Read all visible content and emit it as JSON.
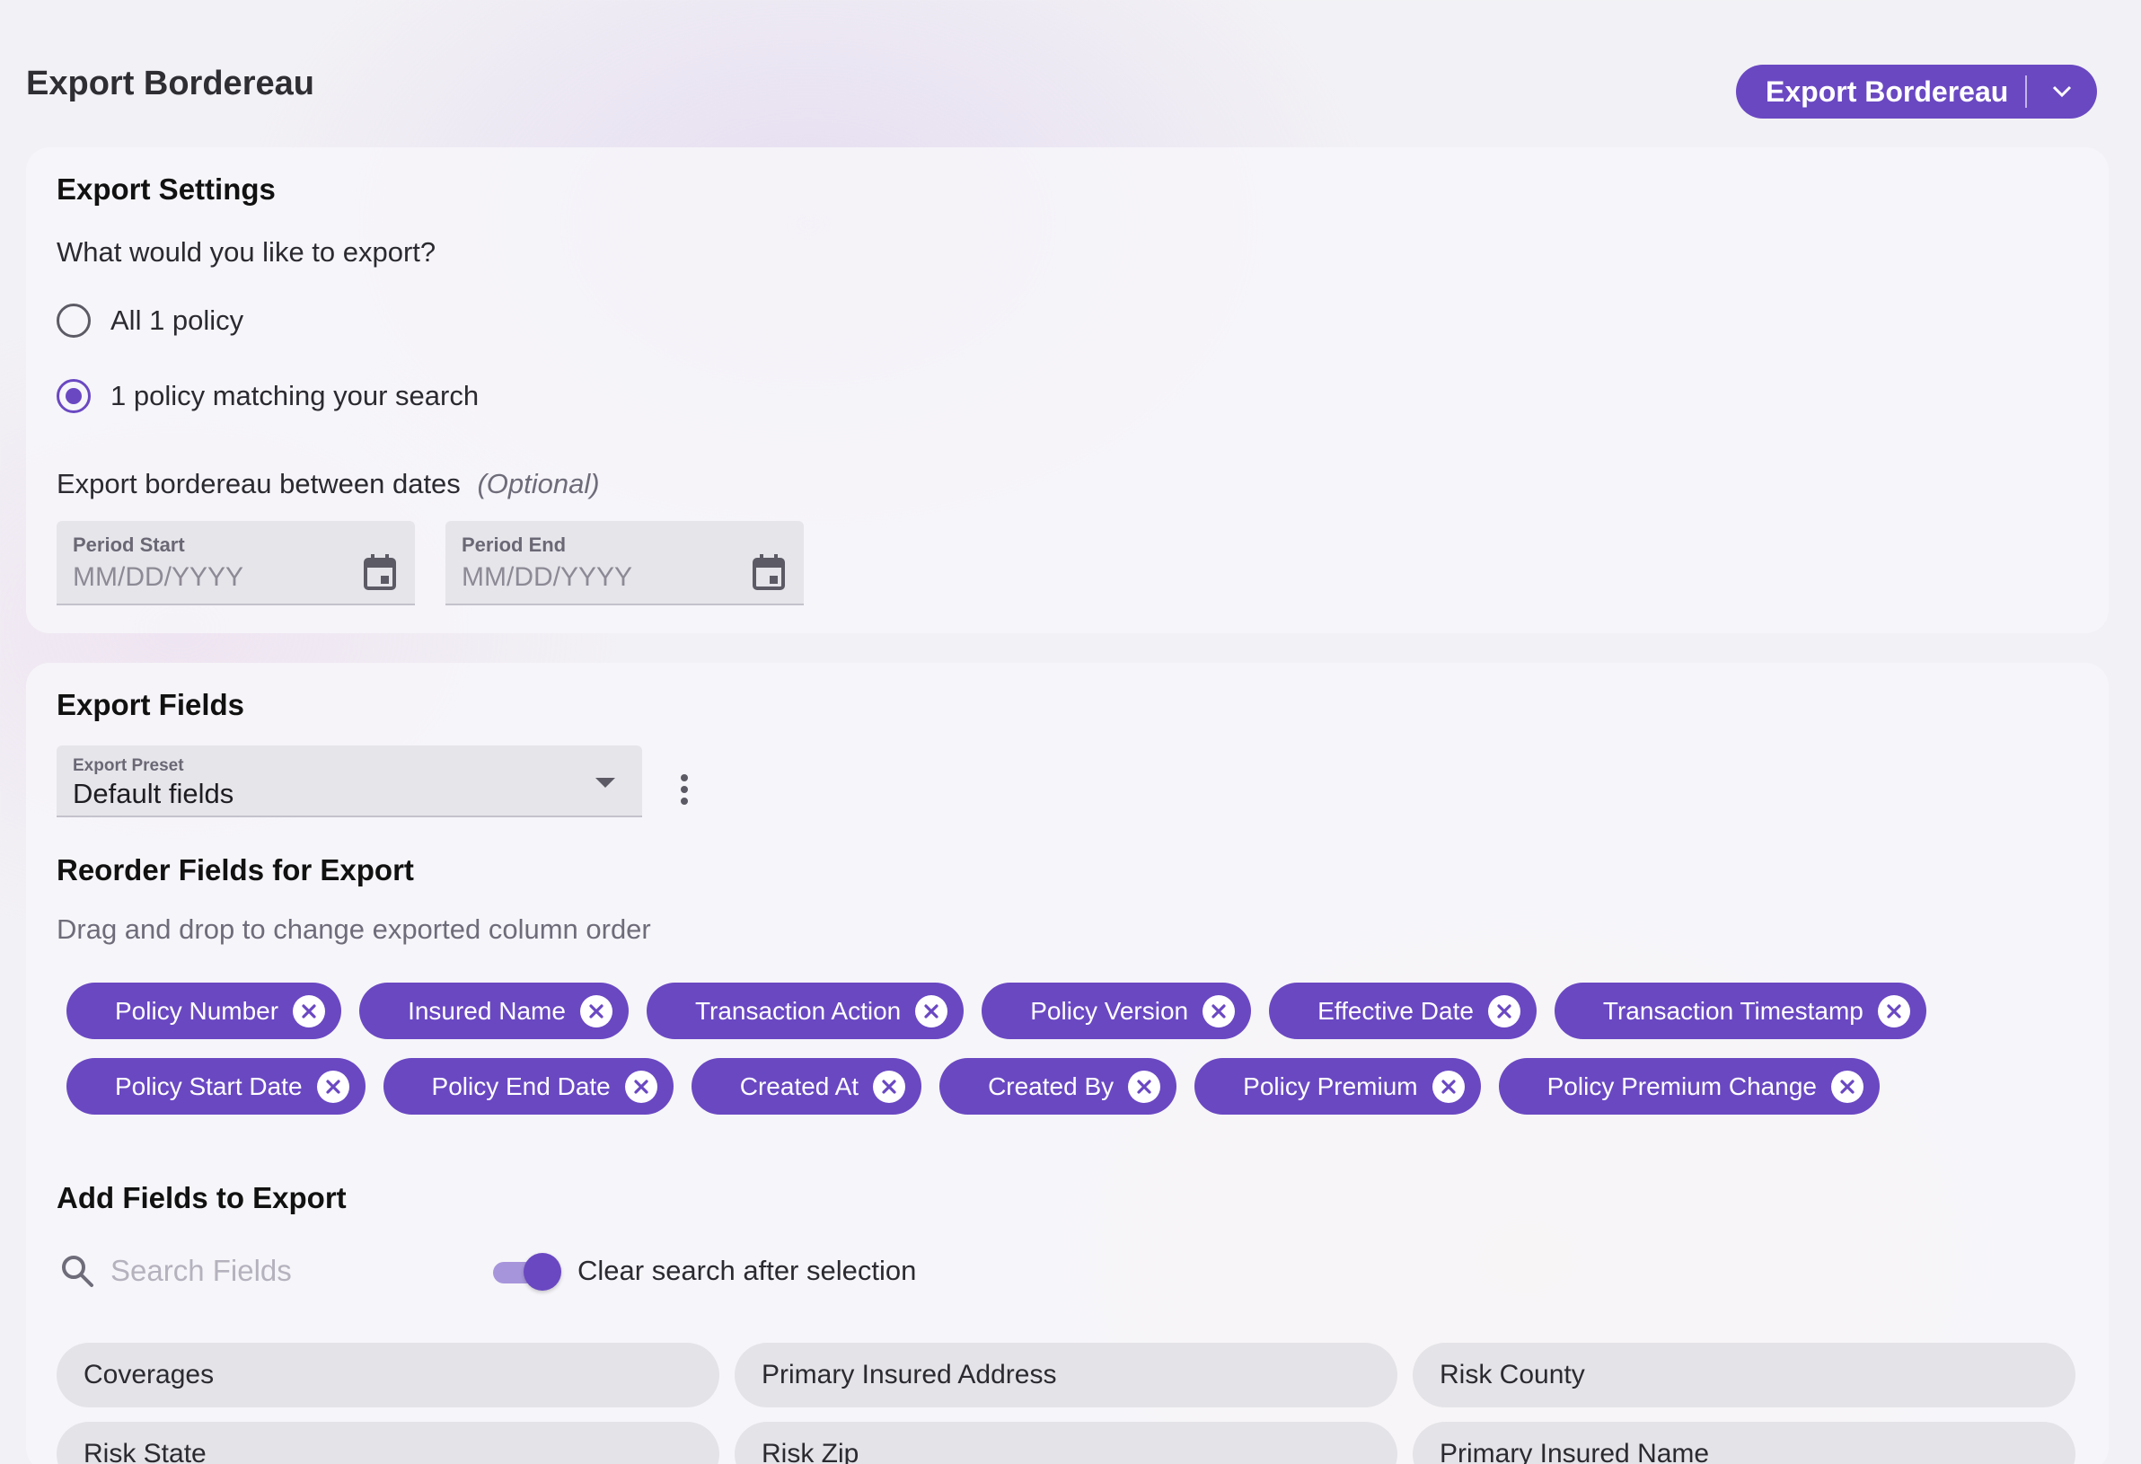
{
  "header": {
    "title": "Export Bordereau",
    "export_button_label": "Export Bordereau"
  },
  "settings": {
    "title": "Export Settings",
    "question": "What would you like to export?",
    "options": [
      {
        "label": "All 1 policy",
        "checked": false
      },
      {
        "label": "1 policy matching your search",
        "checked": true
      }
    ],
    "dates_label": "Export bordereau between dates",
    "dates_optional": "(Optional)",
    "period_start": {
      "label": "Period Start",
      "placeholder": "MM/DD/YYYY"
    },
    "period_end": {
      "label": "Period End",
      "placeholder": "MM/DD/YYYY"
    }
  },
  "fields": {
    "title": "Export Fields",
    "preset": {
      "label": "Export Preset",
      "value": "Default fields"
    },
    "reorder_title": "Reorder Fields for Export",
    "reorder_hint": "Drag and drop to change exported column order",
    "selected_row1": [
      "Policy Number",
      "Insured Name",
      "Transaction Action",
      "Policy Version",
      "Effective Date",
      "Transaction Timestamp"
    ],
    "selected_row2": [
      "Policy Start Date",
      "Policy End Date",
      "Created At",
      "Created By",
      "Policy Premium",
      "Policy Premium Change"
    ],
    "add_title": "Add Fields to Export",
    "search_placeholder": "Search Fields",
    "clear_toggle_label": "Clear search after selection",
    "clear_toggle_on": true,
    "available": [
      "Coverages",
      "Primary Insured Address",
      "Risk County",
      "Risk State",
      "Risk Zip",
      "Primary Insured Name"
    ]
  },
  "colors": {
    "accent": "#6a48c2"
  }
}
